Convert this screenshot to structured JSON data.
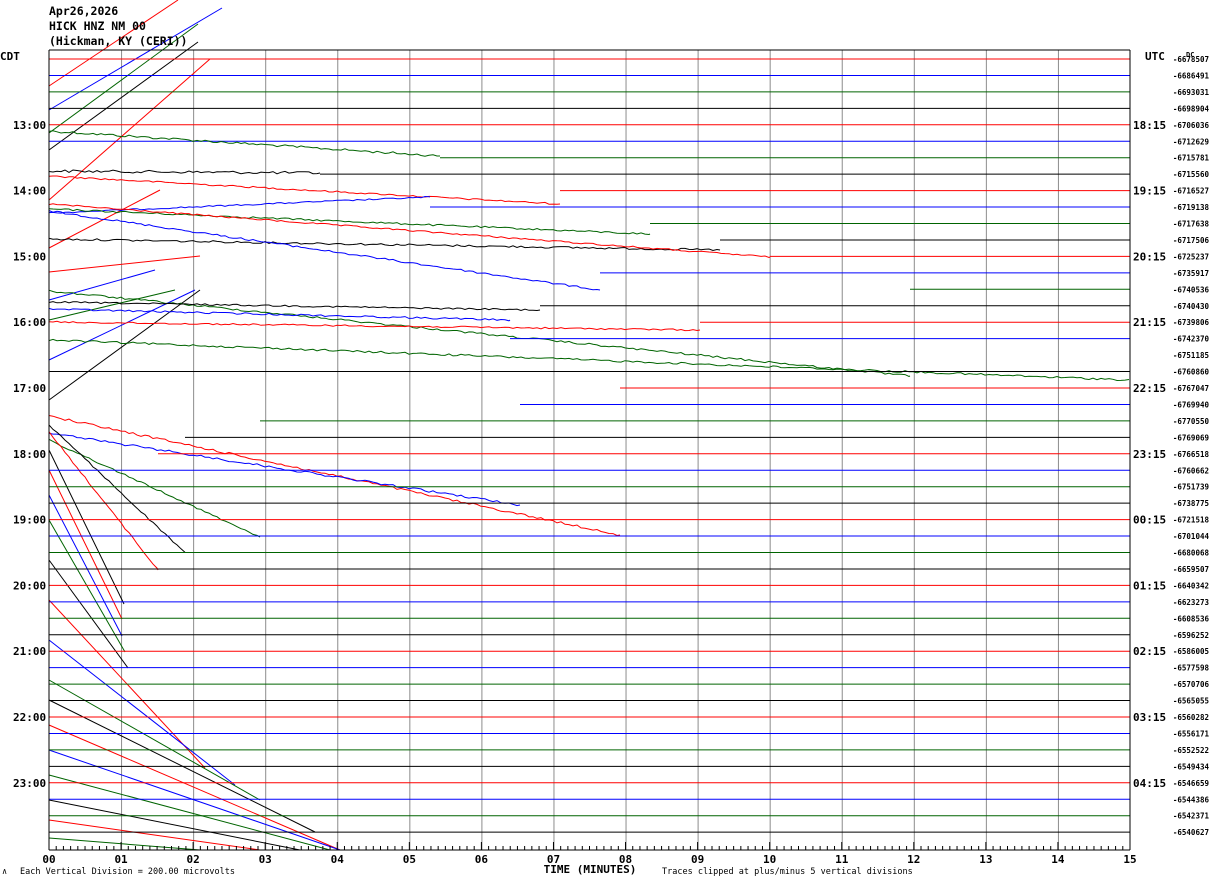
{
  "header": {
    "date": "Apr26,2026",
    "station": "HICK HNZ NM 00",
    "location": "(Hickman, KY (CERI))"
  },
  "footer": {
    "vertical_division": "Each Vertical Division =  200.00 microvolts",
    "clip_note": "Traces clipped at plus/minus 5 vertical divisions"
  },
  "chart_data": {
    "type": "line",
    "title": "",
    "xlabel": "TIME (MINUTES)",
    "left_axis_label": "CDT",
    "right_axis_label": "UTC",
    "right_corner_label": "DC",
    "xlim": [
      0,
      15
    ],
    "x_ticks": [
      "00",
      "01",
      "02",
      "03",
      "04",
      "05",
      "06",
      "07",
      "08",
      "09",
      "10",
      "11",
      "12",
      "13",
      "14",
      "15"
    ],
    "row_count": 48,
    "grid": true,
    "trace_colors": [
      "#000000",
      "#ff0000",
      "#0000ff",
      "#006400"
    ],
    "left_time_labels": [
      {
        "row": 4,
        "text": "13:00"
      },
      {
        "row": 8,
        "text": "14:00"
      },
      {
        "row": 12,
        "text": "15:00"
      },
      {
        "row": 16,
        "text": "16:00"
      },
      {
        "row": 20,
        "text": "17:00"
      },
      {
        "row": 24,
        "text": "18:00"
      },
      {
        "row": 28,
        "text": "19:00"
      },
      {
        "row": 32,
        "text": "20:00"
      },
      {
        "row": 36,
        "text": "21:00"
      },
      {
        "row": 40,
        "text": "22:00"
      },
      {
        "row": 44,
        "text": "23:00"
      }
    ],
    "right_time_labels": [
      {
        "row": 4,
        "text": "18:15"
      },
      {
        "row": 8,
        "text": "19:15"
      },
      {
        "row": 12,
        "text": "20:15"
      },
      {
        "row": 16,
        "text": "21:15"
      },
      {
        "row": 20,
        "text": "22:15"
      },
      {
        "row": 24,
        "text": "23:15"
      },
      {
        "row": 28,
        "text": "00:15"
      },
      {
        "row": 32,
        "text": "01:15"
      },
      {
        "row": 36,
        "text": "02:15"
      },
      {
        "row": 40,
        "text": "03:15"
      },
      {
        "row": 44,
        "text": "04:15"
      }
    ],
    "dc_offsets": [
      "-6678507",
      "-6686491",
      "-6693031",
      "-6698904",
      "-6706036",
      "-6712629",
      "-6715781",
      "-6715560",
      "-6716527",
      "-6719138",
      "-6717638",
      "-6717506",
      "-6725237",
      "-6735917",
      "-6740536",
      "-6740430",
      "-6739806",
      "-6742370",
      "-6751185",
      "-6760860",
      "-6767047",
      "-6769940",
      "-6770550",
      "-6769069",
      "-6766518",
      "-6760662",
      "-6751739",
      "-6738775",
      "-6721518",
      "-6701044",
      "-6680068",
      "-6659507",
      "-6640342",
      "-6623273",
      "-6608536",
      "-6596252",
      "-6586005",
      "-6577598",
      "-6570706",
      "-6565055",
      "-6560282",
      "-6556171",
      "-6552522",
      "-6549434",
      "-6546659",
      "-6544386",
      "-6542371",
      "-6540627"
    ]
  }
}
